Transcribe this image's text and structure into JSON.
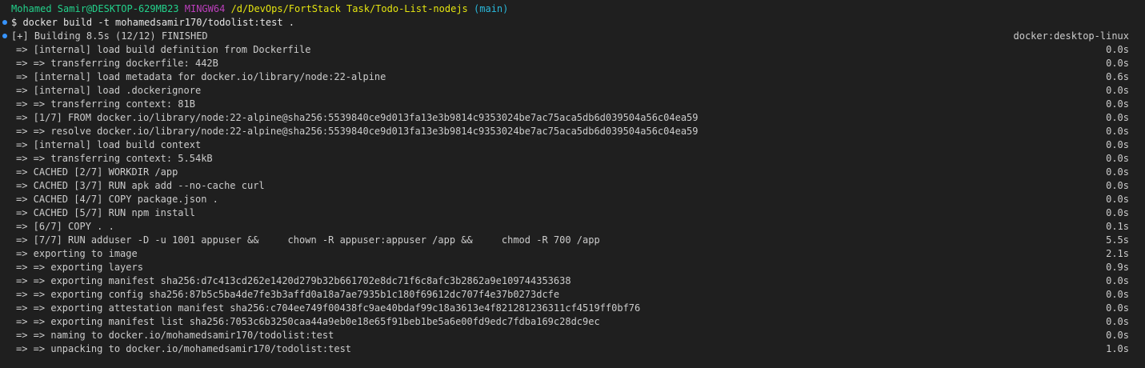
{
  "prompt": {
    "user_host": "Mohamed Samir@DESKTOP-629MB23",
    "system": "MINGW64",
    "path": "/d/DevOps/FortStack Task/Todo-List-nodejs",
    "branch": "(main)"
  },
  "command": {
    "text": "$ docker build -t mohamedsamir170/todolist:test ."
  },
  "status": {
    "text": "[+] Building 8.5s (12/12) FINISHED",
    "builder": "docker:desktop-linux"
  },
  "steps": [
    {
      "text": "=> [internal] load build definition from Dockerfile",
      "time": "0.0s"
    },
    {
      "text": "=> => transferring dockerfile: 442B",
      "time": "0.0s"
    },
    {
      "text": "=> [internal] load metadata for docker.io/library/node:22-alpine",
      "time": "0.6s"
    },
    {
      "text": "=> [internal] load .dockerignore",
      "time": "0.0s"
    },
    {
      "text": "=> => transferring context: 81B",
      "time": "0.0s"
    },
    {
      "text": "=> [1/7] FROM docker.io/library/node:22-alpine@sha256:5539840ce9d013fa13e3b9814c9353024be7ac75aca5db6d039504a56c04ea59",
      "time": "0.0s"
    },
    {
      "text": "=> => resolve docker.io/library/node:22-alpine@sha256:5539840ce9d013fa13e3b9814c9353024be7ac75aca5db6d039504a56c04ea59",
      "time": "0.0s"
    },
    {
      "text": "=> [internal] load build context",
      "time": "0.0s"
    },
    {
      "text": "=> => transferring context: 5.54kB",
      "time": "0.0s"
    },
    {
      "text": "=> CACHED [2/7] WORKDIR /app",
      "time": "0.0s"
    },
    {
      "text": "=> CACHED [3/7] RUN apk add --no-cache curl",
      "time": "0.0s"
    },
    {
      "text": "=> CACHED [4/7] COPY package.json .",
      "time": "0.0s"
    },
    {
      "text": "=> CACHED [5/7] RUN npm install",
      "time": "0.0s"
    },
    {
      "text": "=> [6/7] COPY . .",
      "time": "0.1s"
    },
    {
      "text": "=> [7/7] RUN adduser -D -u 1001 appuser &&     chown -R appuser:appuser /app &&     chmod -R 700 /app",
      "time": "5.5s"
    },
    {
      "text": "=> exporting to image",
      "time": "2.1s"
    },
    {
      "text": "=> => exporting layers",
      "time": "0.9s"
    },
    {
      "text": "=> => exporting manifest sha256:d7c413cd262e1420d279b32b661702e8dc71f6c8afc3b2862a9e109744353638",
      "time": "0.0s"
    },
    {
      "text": "=> => exporting config sha256:87b5c5ba4de7fe3b3affd0a18a7ae7935b1c180f69612dc707f4e37b0273dcfe",
      "time": "0.0s"
    },
    {
      "text": "=> => exporting attestation manifest sha256:c704ee749f00438fc9ae40bdaf99c18a3613e4f821281236311cf4519ff0bf76",
      "time": "0.0s"
    },
    {
      "text": "=> => exporting manifest list sha256:7053c6b3250caa44a9eb0e18e65f91beb1be5a6e00fd9edc7fdba169c28dc9ec",
      "time": "0.0s"
    },
    {
      "text": "=> => naming to docker.io/mohamedsamir170/todolist:test",
      "time": "0.0s"
    },
    {
      "text": "=> => unpacking to docker.io/mohamedsamir170/todolist:test",
      "time": "1.0s"
    }
  ],
  "colors": {
    "background": "#1f1f1f",
    "text": "#cccccc",
    "prompt_user": "#23d18b",
    "prompt_system": "#bc3fbc",
    "prompt_path": "#e5e510",
    "prompt_branch": "#29b8db",
    "command_decoration": "#3794ff"
  }
}
